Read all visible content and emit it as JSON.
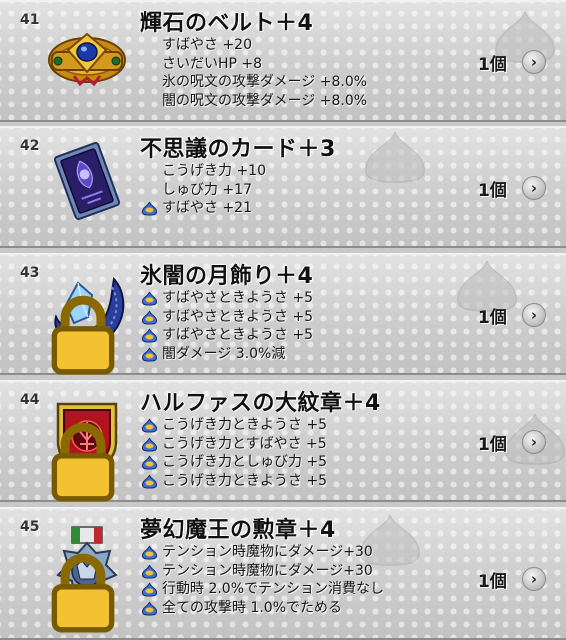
{
  "items": [
    {
      "number": "41",
      "name": "輝石のベルト＋4",
      "icon": "gem-belt-icon",
      "locked": false,
      "stats": [
        {
          "text": "すばやさ +20",
          "star": false
        },
        {
          "text": "さいだいHP +8",
          "star": false
        },
        {
          "text": "氷の呪文の攻撃ダメージ +8.0%",
          "star": false
        },
        {
          "text": "闇の呪文の攻撃ダメージ +8.0%",
          "star": false
        }
      ],
      "count": "1個",
      "detail_glyph": "›"
    },
    {
      "number": "42",
      "name": "不思議のカード＋3",
      "icon": "mystery-card-icon",
      "locked": false,
      "stats": [
        {
          "text": "こうげき力 +10",
          "star": false
        },
        {
          "text": "しゅび力 +17",
          "star": false
        },
        {
          "text": "すばやさ +21",
          "star": true
        }
      ],
      "count": "1個",
      "detail_glyph": "›"
    },
    {
      "number": "43",
      "name": "氷闇の月飾り＋4",
      "icon": "crescent-moon-ornament-icon",
      "locked": true,
      "stats": [
        {
          "text": "すばやさときようさ +5",
          "star": true
        },
        {
          "text": "すばやさときようさ +5",
          "star": true
        },
        {
          "text": "すばやさときようさ +5",
          "star": true
        },
        {
          "text": "闇ダメージ 3.0%減",
          "star": true
        }
      ],
      "count": "1個",
      "detail_glyph": "›"
    },
    {
      "number": "44",
      "name": "ハルファスの大紋章＋4",
      "icon": "crest-emblem-icon",
      "locked": true,
      "stats": [
        {
          "text": "こうげき力ときようさ +5",
          "star": true
        },
        {
          "text": "こうげき力とすばやさ +5",
          "star": true
        },
        {
          "text": "こうげき力としゅび力 +5",
          "star": true
        },
        {
          "text": "こうげき力ときようさ +5",
          "star": true
        }
      ],
      "count": "1個",
      "detail_glyph": "›"
    },
    {
      "number": "45",
      "name": "夢幻魔王の勲章＋4",
      "icon": "demon-king-medal-icon",
      "locked": true,
      "stats": [
        {
          "text": "テンション時魔物にダメージ+30",
          "star": true
        },
        {
          "text": "テンション時魔物にダメージ+30",
          "star": true
        },
        {
          "text": "行動時 2.0%でテンション消費なし",
          "star": true
        },
        {
          "text": "全ての攻撃時 1.0%でためる",
          "star": true
        }
      ],
      "count": "1個",
      "detail_glyph": "›"
    }
  ]
}
